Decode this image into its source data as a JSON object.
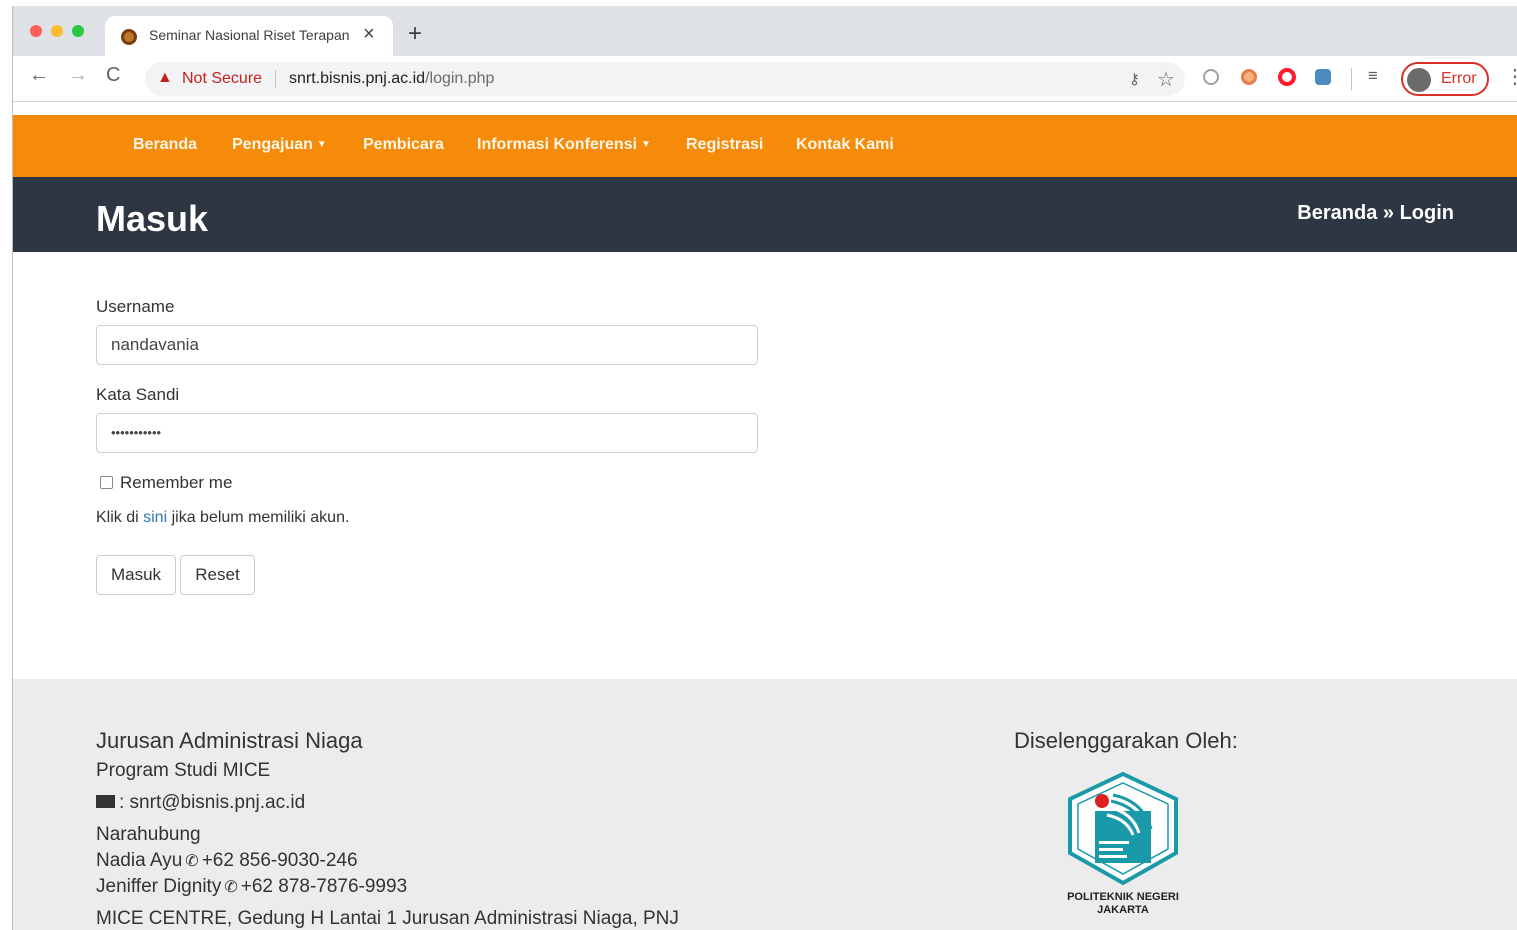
{
  "browser": {
    "tab_title": "Seminar Nasional Riset Terapan",
    "security_label": "Not Secure",
    "url_host": "snrt.bisnis.pnj.ac.id",
    "url_path": "/login.php",
    "profile_status": "Error"
  },
  "navbar": {
    "items": [
      "Beranda",
      "Pengajuan",
      "Pembicara",
      "Informasi Konferensi",
      "Registrasi",
      "Kontak Kami"
    ],
    "brand_color": "#f58b09"
  },
  "header": {
    "title": "Masuk",
    "breadcrumb": "Beranda » Login"
  },
  "form": {
    "username_label": "Username",
    "username_value": "nandavania",
    "password_label": "Kata Sandi",
    "password_value": "•••••••••••",
    "remember_label": "Remember me",
    "register_prefix": "Klik di ",
    "register_link": "sini",
    "register_suffix": " jika belum memiliki akun.",
    "submit_label": "Masuk",
    "reset_label": "Reset"
  },
  "footer": {
    "department": "Jurusan Administrasi Niaga",
    "program": "Program Studi MICE",
    "email": ": snrt@bisnis.pnj.ac.id",
    "contact_heading": "Narahubung",
    "contacts": [
      {
        "name": "Nadia Ayu",
        "phone": "+62 856-9030-246"
      },
      {
        "name": "Jeniffer Dignity",
        "phone": "+62 878-7876-9993"
      }
    ],
    "address": "MICE CENTRE, Gedung H Lantai 1 Jurusan Administrasi Niaga, PNJ",
    "organizer_heading": "Diselenggarakan Oleh:",
    "organizer_logo_text": "POLITEKNIK NEGERI JAKARTA"
  }
}
